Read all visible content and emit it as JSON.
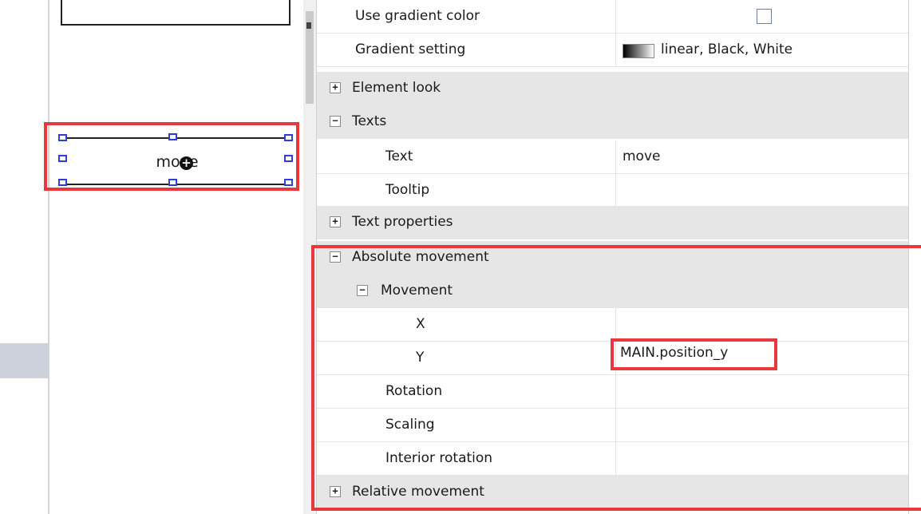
{
  "canvas": {
    "element_text": "move"
  },
  "properties": {
    "use_gradient": {
      "label": "Use gradient color",
      "checked": false
    },
    "gradient_setting": {
      "label": "Gradient setting",
      "value": "linear, Black, White",
      "swatch_from": "#000000",
      "swatch_to": "#ffffff"
    },
    "element_look": {
      "label": "Element look",
      "expander": "+"
    },
    "texts": {
      "label": "Texts",
      "expander": "−"
    },
    "text": {
      "label": "Text",
      "value": "move"
    },
    "tooltip": {
      "label": "Tooltip",
      "value": ""
    },
    "text_properties": {
      "label": "Text properties",
      "expander": "+"
    },
    "absolute_movement": {
      "label": "Absolute movement",
      "expander": "−"
    },
    "movement": {
      "label": "Movement",
      "expander": "−"
    },
    "x": {
      "label": "X",
      "value": ""
    },
    "y": {
      "label": "Y",
      "value": "MAIN.position_y"
    },
    "rotation": {
      "label": "Rotation",
      "value": ""
    },
    "scaling": {
      "label": "Scaling",
      "value": ""
    },
    "interior_rotation": {
      "label": "Interior rotation",
      "value": ""
    },
    "relative_movement": {
      "label": "Relative movement",
      "expander": "+"
    }
  },
  "colors": {
    "highlight": "#e8383d",
    "category_bg": "#e6e6e6",
    "handle": "#2f3fd6"
  }
}
